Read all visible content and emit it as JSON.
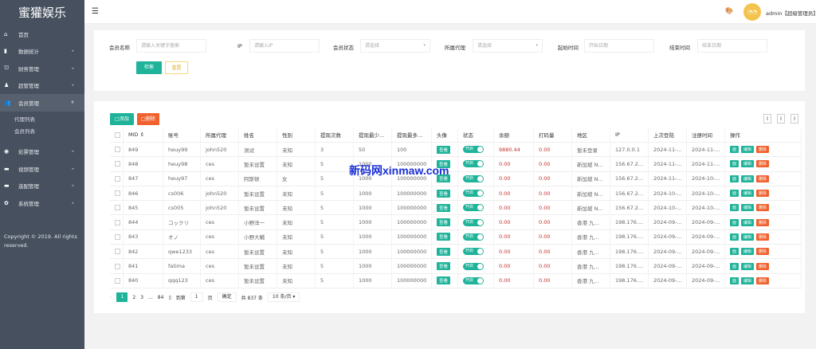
{
  "sidebar": {
    "logo": "蜜獾娱乐",
    "items": [
      {
        "label": "首页",
        "icon": "⌂"
      },
      {
        "label": "数据统计",
        "icon": "▮"
      },
      {
        "label": "财务管理",
        "icon": "⛫"
      },
      {
        "label": "超管管理",
        "icon": "♟"
      },
      {
        "label": "会员管理",
        "icon": "👥"
      }
    ],
    "subitems": [
      "代理列表",
      "会员列表"
    ],
    "items2": [
      {
        "label": "彩票管理",
        "icon": "◉"
      },
      {
        "label": "视频管理",
        "icon": "▬"
      },
      {
        "label": "选配管理",
        "icon": "▬"
      },
      {
        "label": "系统管理",
        "icon": "✿"
      }
    ],
    "copyright": "Copyright © 2019. All rights reserved."
  },
  "header": {
    "user": "admin【超级管理员】"
  },
  "search": {
    "fields": [
      {
        "label": "会员名称",
        "placeholder": "请输入关键字搜索"
      },
      {
        "label": "IP",
        "placeholder": "请输入IP"
      },
      {
        "label": "会员状态",
        "placeholder": "请选择"
      },
      {
        "label": "所属代理",
        "placeholder": "请选择"
      },
      {
        "label": "起始时间",
        "placeholder": "开始日期"
      },
      {
        "label": "结束时间",
        "placeholder": "结束日期"
      }
    ],
    "search_btn": "检索",
    "reset_btn": "重置"
  },
  "toolbar": {
    "add": "□添加",
    "delete": "□删除"
  },
  "table": {
    "headers": [
      "",
      "MID ⇕",
      "账号",
      "所属代理",
      "姓名",
      "性别",
      "提现次数",
      "提现最少...",
      "提现最多...",
      "头像",
      "状态",
      "余额",
      "打码量",
      "地区",
      "IP",
      "上次登陆",
      "注册时间",
      "操作"
    ],
    "view": "查看",
    "switch": "开启",
    "actions": [
      "面",
      "编辑",
      "删除"
    ],
    "rows": [
      [
        "849",
        "heuy99",
        "john520",
        "测试",
        "未知",
        "3",
        "50",
        "100",
        "9880.44",
        "0.00",
        "暂未登录",
        "127.0.0.1",
        "2024-11-...",
        "2024-11-..."
      ],
      [
        "848",
        "heuy98",
        "ces",
        "暂未设置",
        "未知",
        "5",
        "1000",
        "100000000",
        "0.00",
        "0.00",
        "新加坡 N...",
        "156.67.2...",
        "2024-11-...",
        "2024-11-..."
      ],
      [
        "847",
        "heuy97",
        "ces",
        "阿斯顿",
        "女",
        "5",
        "1000",
        "100000000",
        "0.00",
        "0.00",
        "新加坡 N...",
        "156.67.2...",
        "2024-11-...",
        "2024-10-..."
      ],
      [
        "846",
        "cs006",
        "john520",
        "暂未设置",
        "未知",
        "5",
        "1000",
        "100000000",
        "0.00",
        "0.00",
        "新加坡 N...",
        "156.67.2...",
        "2024-10-...",
        "2024-10-..."
      ],
      [
        "845",
        "cs005",
        "john520",
        "暂未设置",
        "未知",
        "5",
        "1000",
        "100000000",
        "0.00",
        "0.00",
        "新加坡 N...",
        "156.67.2...",
        "2024-10-...",
        "2024-10-..."
      ],
      [
        "844",
        "コックリ",
        "ces",
        "小野洋一",
        "未知",
        "5",
        "1000",
        "100000000",
        "0.00",
        "0.00",
        "香港 九...",
        "198.176....",
        "2024-09-...",
        "2024-09-..."
      ],
      [
        "843",
        "オノ",
        "ces",
        "小野大輔",
        "未知",
        "5",
        "1000",
        "100000000",
        "0.00",
        "0.00",
        "香港 九...",
        "198.176....",
        "2024-09-...",
        "2024-09-..."
      ],
      [
        "842",
        "qwe1233",
        "ces",
        "暂未设置",
        "未知",
        "5",
        "1000",
        "100000000",
        "0.00",
        "0.00",
        "香港 九...",
        "198.176....",
        "2024-09-...",
        "2024-09-..."
      ],
      [
        "841",
        "fatima",
        "ces",
        "暂未设置",
        "未知",
        "5",
        "1000",
        "100000000",
        "0.00",
        "0.00",
        "香港 九...",
        "198.176....",
        "2024-09-...",
        "2024-09-..."
      ],
      [
        "840",
        "qqq123",
        "ces",
        "暂未设置",
        "未知",
        "5",
        "1000",
        "100000000",
        "0.00",
        "0.00",
        "香港 九...",
        "198.176....",
        "2024-09-...",
        "2024-09-..."
      ]
    ]
  },
  "pager": {
    "pages": [
      "1",
      "2",
      "3",
      "...",
      "84"
    ],
    "goto": "到第",
    "page_value": "1",
    "page_unit": "页",
    "confirm": "确定",
    "total": "共 837 条",
    "per_page": "10 条/页"
  },
  "watermark": "新码网xinmaw.com",
  "colors": {
    "sidebar": "#46505f",
    "primary": "#1fb39a",
    "danger": "#f0612e",
    "reset_border": "#f5d97a"
  }
}
